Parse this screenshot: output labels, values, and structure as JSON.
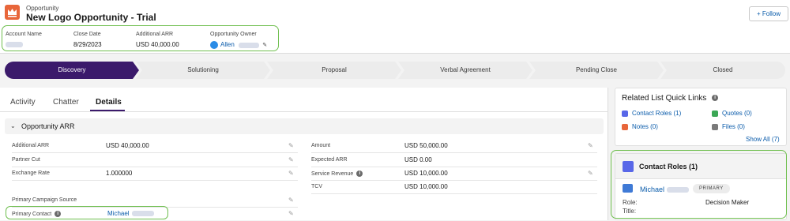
{
  "header": {
    "object_type": "Opportunity",
    "title": "New Logo Opportunity - Trial",
    "follow_label": "Follow",
    "follow_icon": "plus-icon",
    "object_icon": "crown-icon",
    "fields": [
      {
        "label": "Account Name",
        "value": ""
      },
      {
        "label": "Close Date",
        "value": "8/29/2023"
      },
      {
        "label": "Additional ARR",
        "value": "USD 40,000.00"
      },
      {
        "label": "Opportunity Owner",
        "value": "Allen"
      }
    ]
  },
  "path": {
    "stages": [
      "Discovery",
      "Solutioning",
      "Proposal",
      "Verbal Agreement",
      "Pending Close",
      "Closed"
    ],
    "active_index": 0,
    "active_color": "#3b1a6b"
  },
  "tabs": [
    "Activity",
    "Chatter",
    "Details"
  ],
  "active_tab": "Details",
  "section": {
    "title": "Opportunity ARR"
  },
  "details_left": [
    {
      "label": "Additional ARR",
      "value": "USD 40,000.00"
    },
    {
      "label": "Partner Cut",
      "value": ""
    },
    {
      "label": "Exchange Rate",
      "value": "1.000000"
    },
    {
      "label": "Primary Campaign Source",
      "value": ""
    },
    {
      "label": "Primary Contact",
      "value": "Michael"
    }
  ],
  "details_right": [
    {
      "label": "Amount",
      "value": "USD 50,000.00"
    },
    {
      "label": "Expected ARR",
      "value": "USD 0.00"
    },
    {
      "label": "Service Revenue",
      "value": "USD 10,000.00"
    },
    {
      "label": "TCV",
      "value": "USD 10,000.00"
    }
  ],
  "related": {
    "title": "Related List Quick Links",
    "links": [
      {
        "label": "Contact Roles (1)",
        "color": "#5867e8"
      },
      {
        "label": "Quotes (0)",
        "color": "#3ba755"
      },
      {
        "label": "Notes (0)",
        "color": "#e8663a"
      },
      {
        "label": "Files (0)",
        "color": "#7a7a7a"
      }
    ],
    "show_all": "Show All (7)"
  },
  "contact_roles": {
    "title": "Contact Roles (1)",
    "name": "Michael",
    "badge": "PRIMARY",
    "role_label": "Role:",
    "role_value": "Decision Maker",
    "title_label": "Title:"
  },
  "colors": {
    "highlight": "#6fbf4f",
    "link": "#0b5cab"
  }
}
